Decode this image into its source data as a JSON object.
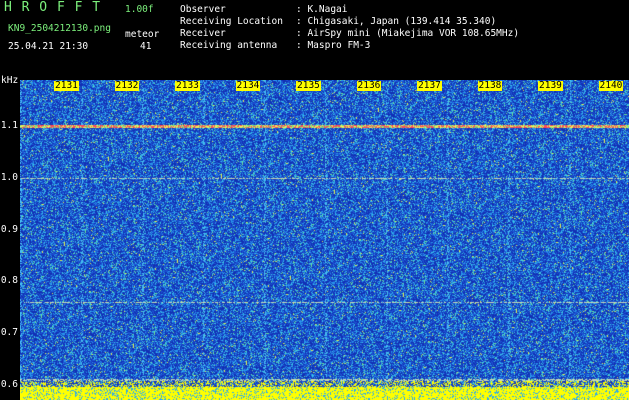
{
  "app": {
    "name": "H R O F F T",
    "version": "1.00f",
    "filename": "KN9_2504212130.png",
    "meteor_label": "meteor",
    "meteor_count": "41",
    "datetime": "25.04.21 21:30"
  },
  "info": {
    "observer_label": "Observer",
    "observer_value": ": K.Nagai",
    "location_label": "Receiving Location",
    "location_value": ": Chigasaki, Japan (139.414 35.340)",
    "receiver_label": "Receiver",
    "receiver_value": ": AirSpy mini (Miakejima VOR 108.65MHz)",
    "antenna_label": "Receiving antenna",
    "antenna_value": ": Maspro FM-3"
  },
  "chart_data": {
    "type": "heatmap",
    "ylabel": "kHz",
    "x_ticks": [
      "2131",
      "2132",
      "2133",
      "2134",
      "2135",
      "2136",
      "2137",
      "2138",
      "2139",
      "2140"
    ],
    "y_ticks": [
      "1.1",
      "1.0",
      "0.9",
      "0.8",
      "0.7",
      "0.6"
    ],
    "ylim": [
      0.57,
      1.19
    ],
    "colors": {
      "background": "#1a3fc4",
      "noise_high": "#2aa8f0",
      "signal": "#ffff00",
      "carrier": "#ff4060"
    },
    "carrier_khz": 1.1,
    "faint_lines_khz": [
      1.0,
      0.76,
      0.61
    ]
  }
}
